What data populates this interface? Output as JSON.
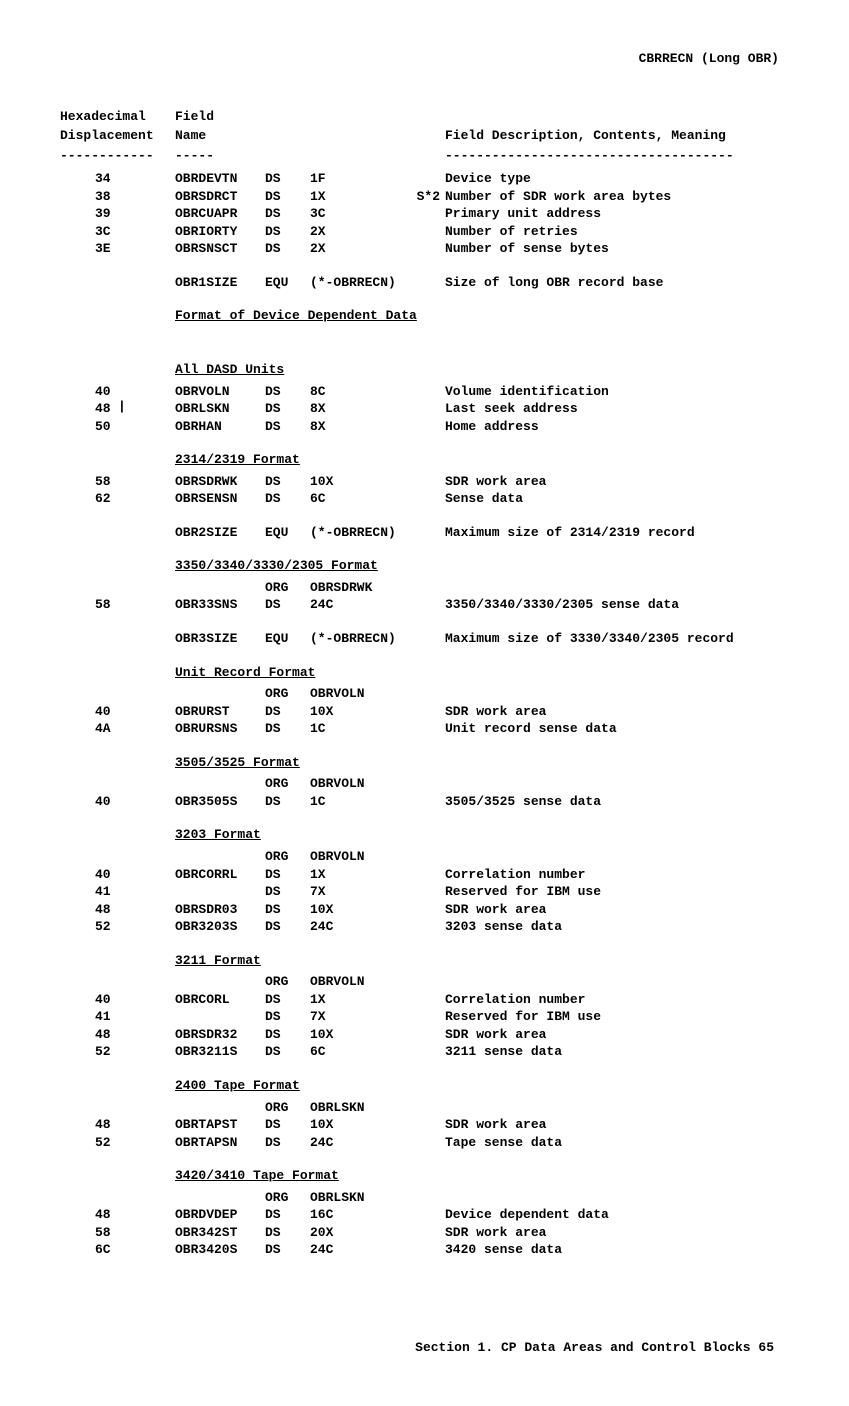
{
  "header": "CBRRECN (Long OBR)",
  "cols": {
    "disp1": "Hexadecimal",
    "disp2": "Displacement",
    "name1": "Field",
    "name2": "Name",
    "desc": "Field Description, Contents, Meaning",
    "dash_disp": "------------",
    "dash_name": "-----",
    "dash_desc": "-------------------------------------"
  },
  "groups": [
    {
      "rows": [
        {
          "d": "34",
          "n": "OBRDEVTN",
          "o": "DS",
          "a": "1F",
          "note": "",
          "desc": "Device type"
        },
        {
          "d": "38",
          "n": "OBRSDRCT",
          "o": "DS",
          "a": "1X",
          "note": "S*2",
          "desc": "Number of SDR work area bytes"
        },
        {
          "d": "39",
          "n": "OBRCUAPR",
          "o": "DS",
          "a": "3C",
          "note": "",
          "desc": "Primary unit address"
        },
        {
          "d": "3C",
          "n": "OBRIORTY",
          "o": "DS",
          "a": "2X",
          "note": "",
          "desc": "Number of retries"
        },
        {
          "d": "3E",
          "n": "OBRSNSCT",
          "o": "DS",
          "a": "2X",
          "note": "",
          "desc": "Number of sense bytes"
        }
      ]
    },
    {
      "rows": [
        {
          "d": "",
          "n": "OBR1SIZE",
          "o": "EQU",
          "a": "(*-OBRRECN)",
          "note": "",
          "desc": "Size of long OBR record base"
        }
      ]
    }
  ],
  "sec_device_dep": "Format of Device Dependent Data",
  "sec_dasd": "All DASD Units",
  "dasd_rows": [
    {
      "d": "40",
      "n": "OBRVOLN",
      "o": "DS",
      "a": "8C",
      "note": "",
      "desc": "Volume identification"
    },
    {
      "d": "48",
      "n": "OBRLSKN",
      "o": "DS",
      "a": "8X",
      "note": "",
      "desc": "Last seek address"
    },
    {
      "d": "50",
      "n": "OBRHAN",
      "o": "DS",
      "a": "8X",
      "note": "",
      "desc": "Home address"
    }
  ],
  "sec_2314": "2314/2319 Format",
  "r2314": [
    {
      "d": "58",
      "n": "OBRSDRWK",
      "o": "DS",
      "a": "10X",
      "note": "",
      "desc": "SDR work area"
    },
    {
      "d": "62",
      "n": "OBRSENSN",
      "o": "DS",
      "a": "6C",
      "note": "",
      "desc": "Sense data"
    }
  ],
  "r2314b": [
    {
      "d": "",
      "n": "OBR2SIZE",
      "o": "EQU",
      "a": "(*-OBRRECN)",
      "note": "",
      "desc": "Maximum size of 2314/2319 record"
    }
  ],
  "sec_3350": "3350/3340/3330/2305 Format",
  "r3350": [
    {
      "d": "",
      "n": "",
      "o": "ORG",
      "a": "OBRSDRWK",
      "note": "",
      "desc": ""
    },
    {
      "d": "58",
      "n": "OBR33SNS",
      "o": "DS",
      "a": "24C",
      "note": "",
      "desc": "3350/3340/3330/2305 sense data"
    }
  ],
  "r3350b": [
    {
      "d": "",
      "n": "OBR3SIZE",
      "o": "EQU",
      "a": "(*-OBRRECN)",
      "note": "",
      "desc": "Maximum size of 3330/3340/2305 record"
    }
  ],
  "sec_ur": "Unit Record Format",
  "rur": [
    {
      "d": "",
      "n": "",
      "o": "ORG",
      "a": "OBRVOLN",
      "note": "",
      "desc": ""
    },
    {
      "d": "40",
      "n": "OBRURST",
      "o": "DS",
      "a": "10X",
      "note": "",
      "desc": "SDR work area"
    },
    {
      "d": "4A",
      "n": "OBRURSNS",
      "o": "DS",
      "a": "1C",
      "note": "",
      "desc": "Unit record sense data"
    }
  ],
  "sec_3505": "3505/3525 Format",
  "r3505": [
    {
      "d": "",
      "n": "",
      "o": "ORG",
      "a": "OBRVOLN",
      "note": "",
      "desc": ""
    },
    {
      "d": "40",
      "n": "OBR3505S",
      "o": "DS",
      "a": "1C",
      "note": "",
      "desc": "3505/3525 sense data"
    }
  ],
  "sec_3203": "3203 Format",
  "r3203": [
    {
      "d": "",
      "n": "",
      "o": "ORG",
      "a": "OBRVOLN",
      "note": "",
      "desc": ""
    },
    {
      "d": "40",
      "n": "OBRCORRL",
      "o": "DS",
      "a": "1X",
      "note": "",
      "desc": "Correlation number"
    },
    {
      "d": "41",
      "n": "",
      "o": "DS",
      "a": "7X",
      "note": "",
      "desc": "Reserved for IBM use"
    },
    {
      "d": "48",
      "n": "OBRSDR03",
      "o": "DS",
      "a": "10X",
      "note": "",
      "desc": "SDR work area"
    },
    {
      "d": "52",
      "n": "OBR3203S",
      "o": "DS",
      "a": "24C",
      "note": "",
      "desc": "3203 sense data"
    }
  ],
  "sec_3211": "3211 Format",
  "r3211": [
    {
      "d": "",
      "n": "",
      "o": "ORG",
      "a": "OBRVOLN",
      "note": "",
      "desc": ""
    },
    {
      "d": "40",
      "n": "OBRCORL",
      "o": "DS",
      "a": "1X",
      "note": "",
      "desc": "Correlation number"
    },
    {
      "d": "41",
      "n": "",
      "o": "DS",
      "a": "7X",
      "note": "",
      "desc": "Reserved for IBM use"
    },
    {
      "d": "48",
      "n": "OBRSDR32",
      "o": "DS",
      "a": "10X",
      "note": "",
      "desc": "SDR work area"
    },
    {
      "d": "52",
      "n": "OBR3211S",
      "o": "DS",
      "a": "6C",
      "note": "",
      "desc": "3211 sense data"
    }
  ],
  "sec_2400": "2400 Tape Format",
  "r2400": [
    {
      "d": "",
      "n": "",
      "o": "ORG",
      "a": "OBRLSKN",
      "note": "",
      "desc": ""
    },
    {
      "d": "48",
      "n": "OBRTAPST",
      "o": "DS",
      "a": "10X",
      "note": "",
      "desc": "SDR work area"
    },
    {
      "d": "52",
      "n": "OBRTAPSN",
      "o": "DS",
      "a": "24C",
      "note": "",
      "desc": "Tape sense data"
    }
  ],
  "sec_3420": "3420/3410 Tape Format",
  "r3420": [
    {
      "d": "",
      "n": "",
      "o": "ORG",
      "a": "OBRLSKN",
      "note": "",
      "desc": ""
    },
    {
      "d": "48",
      "n": "OBRDVDEP",
      "o": "DS",
      "a": "16C",
      "note": "",
      "desc": "Device dependent data"
    },
    {
      "d": "58",
      "n": "OBR342ST",
      "o": "DS",
      "a": "20X",
      "note": "",
      "desc": "SDR work area"
    },
    {
      "d": "6C",
      "n": "OBR3420S",
      "o": "DS",
      "a": "24C",
      "note": "",
      "desc": "3420 sense data"
    }
  ],
  "footer": "Section 1. CP Data Areas and Control Blocks   65"
}
